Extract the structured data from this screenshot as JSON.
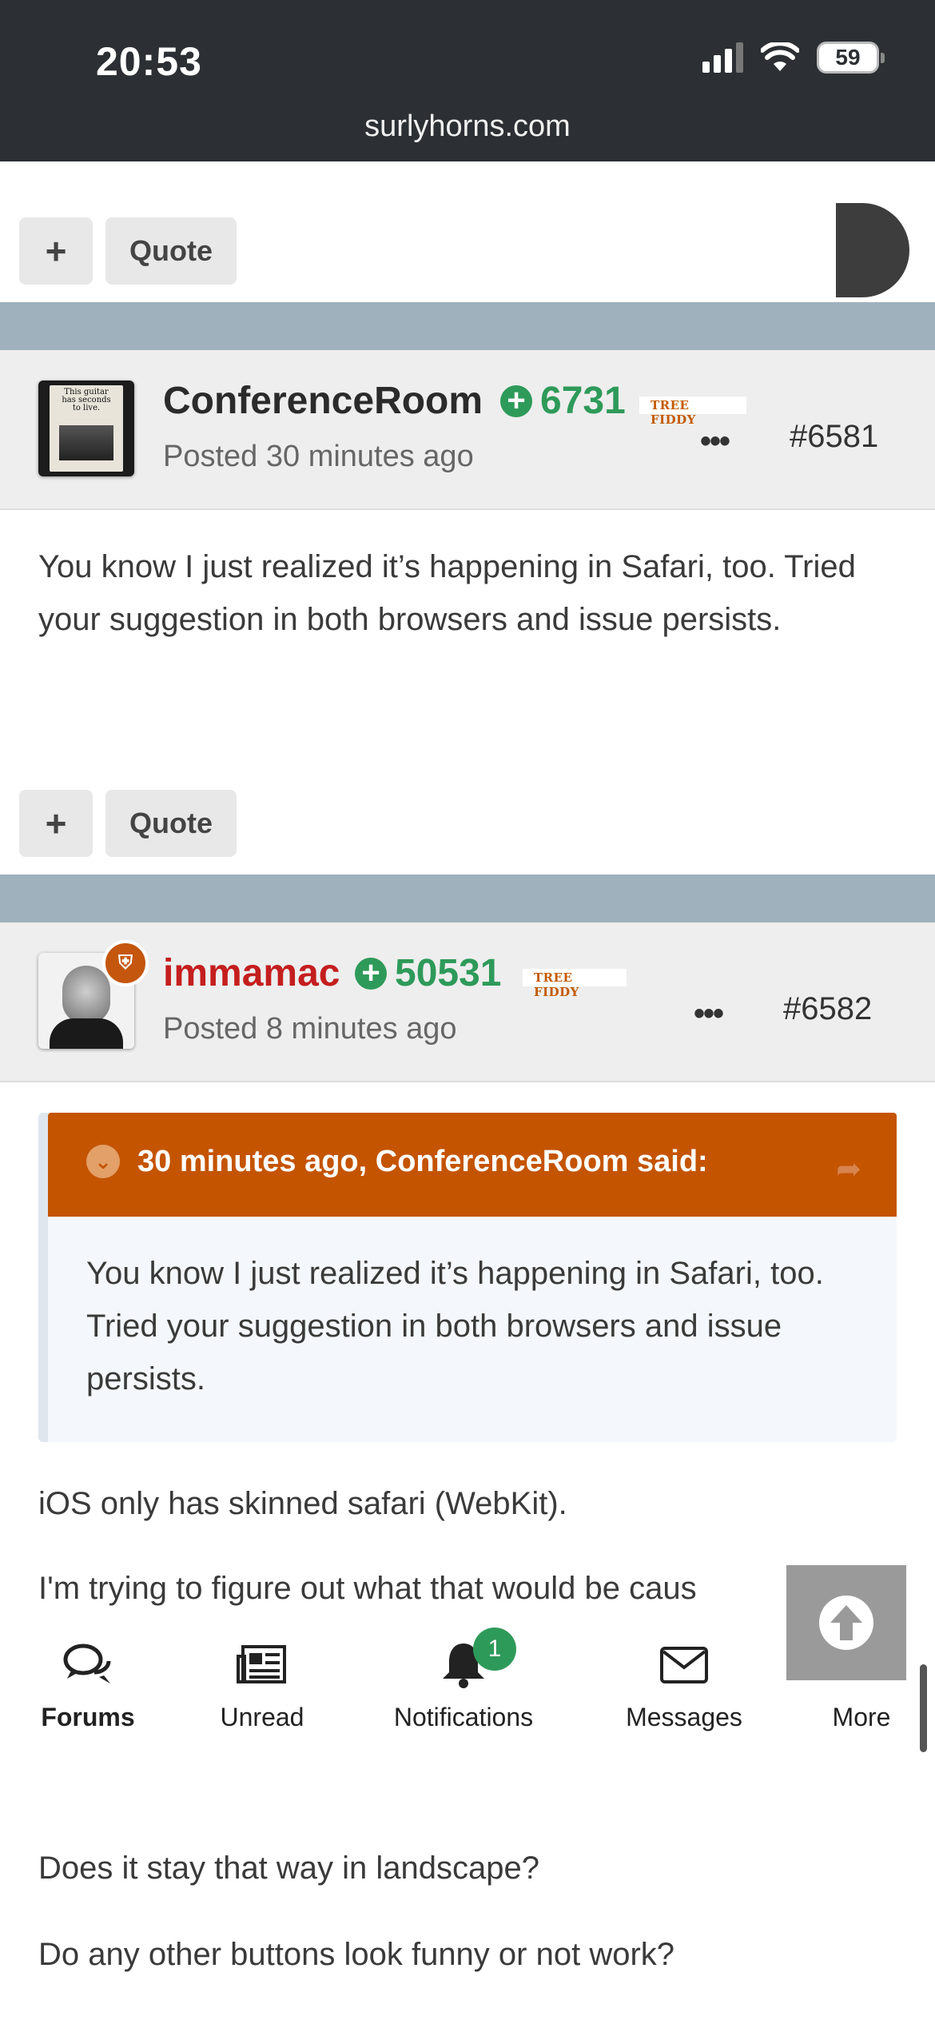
{
  "status_bar": {
    "time": "20:53",
    "battery": "59"
  },
  "browser": {
    "url": "surlyhorns.com"
  },
  "post_actions": {
    "plus_label": "+",
    "quote_label": "Quote"
  },
  "posts": [
    {
      "author": "ConferenceRoom",
      "reputation": "6731",
      "rank": "TREE FIDDY",
      "posted": "Posted 30 minutes ago",
      "number": "#6581",
      "menu": "•••",
      "avatar_text": "This guitar has seconds to live.",
      "body": "You know I just realized it’s happening in Safari, too. Tried your suggestion in both browsers and issue persists."
    },
    {
      "author": "immamac",
      "reputation": "50531",
      "rank": "TREE FIDDY",
      "posted": "Posted 8 minutes ago",
      "number": "#6582",
      "menu": "•••",
      "quote": {
        "title": "30 minutes ago, ConferenceRoom said:",
        "text": "You know I just realized it’s happening in Safari, too. Tried your suggestion in both browsers and issue persists."
      },
      "paragraphs": [
        "iOS only has skinned safari (WebKit).",
        "I'm trying to figure out what that would be caus",
        "Does it stay that way in landscape?",
        "Do any other buttons look funny or not work?"
      ]
    }
  ],
  "bottom_nav": {
    "items": [
      {
        "label": "Forums",
        "icon": "chat-bubbles-icon"
      },
      {
        "label": "Unread",
        "icon": "newspaper-icon"
      },
      {
        "label": "Notifications",
        "icon": "bell-icon",
        "badge": "1"
      },
      {
        "label": "Messages",
        "icon": "envelope-icon"
      },
      {
        "label": "More",
        "icon": "more-icon"
      }
    ]
  },
  "colors": {
    "accent_orange": "#c45400",
    "reputation_green": "#2e9a5a",
    "author_red": "#c41e1e",
    "divider": "#9fb1bc"
  }
}
